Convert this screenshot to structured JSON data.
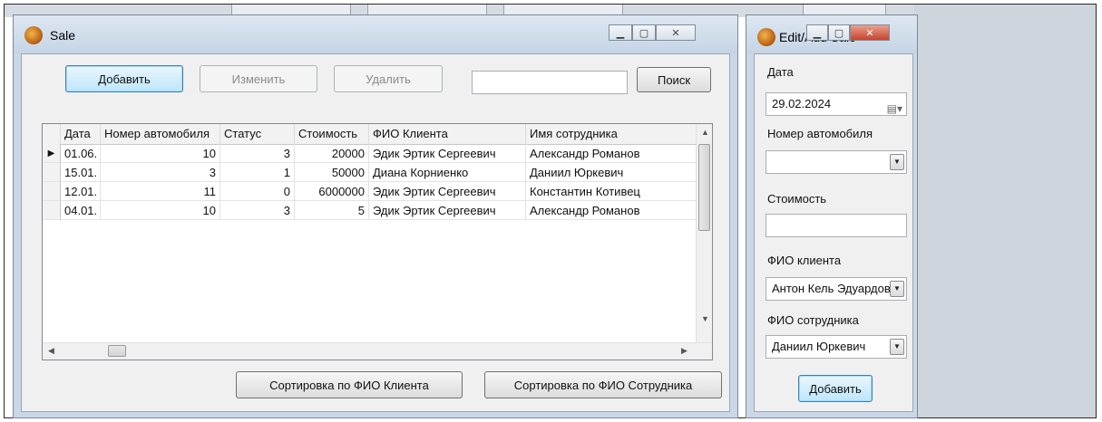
{
  "main_window": {
    "title": "Sale",
    "icon": "app-icon",
    "toolbar": {
      "add_label": "Добавить",
      "edit_label": "Изменить",
      "delete_label": "Удалить",
      "search_value": "",
      "search_label": "Поиск"
    },
    "grid": {
      "columns": [
        "Дата",
        "Номер автомобиля",
        "Статус",
        "Стоимость",
        "ФИО Клиента",
        "Имя сотрудника"
      ],
      "rows": [
        {
          "date": "01.06.",
          "car": "10",
          "status": "3",
          "cost": "20000",
          "client": "Эдик Эртик Сергеевич",
          "employee": "Александр Романов"
        },
        {
          "date": "15.01.",
          "car": "3",
          "status": "1",
          "cost": "50000",
          "client": "Диана Корниенко",
          "employee": "Даниил Юркевич"
        },
        {
          "date": "12.01.",
          "car": "11",
          "status": "0",
          "cost": "6000000",
          "client": "Эдик Эртик Сергеевич",
          "employee": "Константин Котивец"
        },
        {
          "date": "04.01.",
          "car": "10",
          "status": "3",
          "cost": "5",
          "client": "Эдик Эртик Сергеевич",
          "employee": "Александр Романов"
        }
      ],
      "current_row_marker": "▶"
    },
    "sort_by_client_label": "Сортировка по ФИО Клиента",
    "sort_by_employee_label": "Сортировка по ФИО Сотрудника"
  },
  "edit_window": {
    "title": "Edit/Add Sale",
    "date_label": "Дата",
    "date_value": "29.02.2024",
    "car_label": "Номер автомобиля",
    "car_value": "",
    "cost_label": "Стоимость",
    "cost_value": "",
    "client_label": "ФИО клиента",
    "client_value": "Антон Кель Эдуардович",
    "employee_label": "ФИО сотрудника",
    "employee_value": "Даниил Юркевич",
    "submit_label": "Добавить"
  },
  "background_fragments": [
    "Добавить",
    "Изменить",
    "Удалить",
    "Поиск"
  ]
}
